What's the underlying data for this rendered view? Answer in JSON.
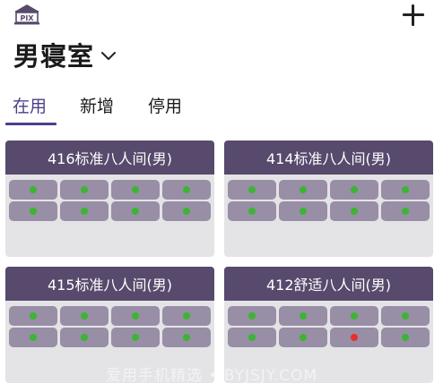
{
  "header": {
    "logo_text": "PIX",
    "title": "男寝室",
    "add_icon": "plus-icon",
    "dropdown_icon": "chevron-down-icon"
  },
  "tabs": [
    {
      "label": "在用",
      "active": true
    },
    {
      "label": "新增",
      "active": false
    },
    {
      "label": "停用",
      "active": false
    }
  ],
  "colors": {
    "accent": "#4b3f8a",
    "card_header": "#574a6c",
    "bed": "#988ea6",
    "card_bg": "#e4e4e6",
    "status_free": "#3cb531",
    "status_occupied": "#e8302a"
  },
  "rooms": [
    {
      "name": "416标准八人间(男)",
      "beds": [
        "free",
        "free",
        "free",
        "free",
        "free",
        "free",
        "free",
        "free"
      ]
    },
    {
      "name": "414标准八人间(男)",
      "beds": [
        "free",
        "free",
        "free",
        "free",
        "free",
        "free",
        "free",
        "free"
      ]
    },
    {
      "name": "415标准八人间(男)",
      "beds": [
        "free",
        "free",
        "free",
        "free",
        "free",
        "free",
        "free",
        "free"
      ]
    },
    {
      "name": "412舒适八人间(男)",
      "beds": [
        "free",
        "free",
        "free",
        "free",
        "free",
        "free",
        "occupied",
        "free"
      ]
    }
  ],
  "watermark": "爱用手机精选 • BYJSJY.COM"
}
